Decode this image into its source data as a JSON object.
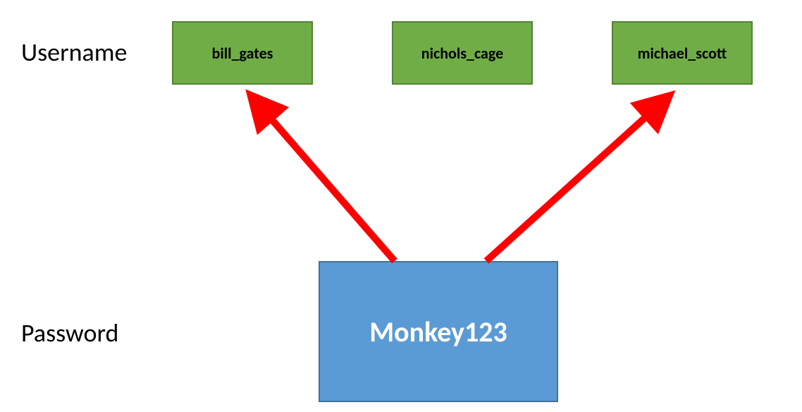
{
  "labels": {
    "username": "Username",
    "password": "Password"
  },
  "usernames": [
    "bill_gates",
    "nichols_cage",
    "michael_scott"
  ],
  "password": "Monkey123",
  "colors": {
    "username_box_fill": "#70AD47",
    "username_box_border": "#548235",
    "password_box_fill": "#5B9BD5",
    "password_box_border": "#41719C",
    "arrow": "#FF0000"
  },
  "arrows": [
    {
      "from": "password",
      "to_index": 0
    },
    {
      "from": "password",
      "to_index": 2
    }
  ]
}
